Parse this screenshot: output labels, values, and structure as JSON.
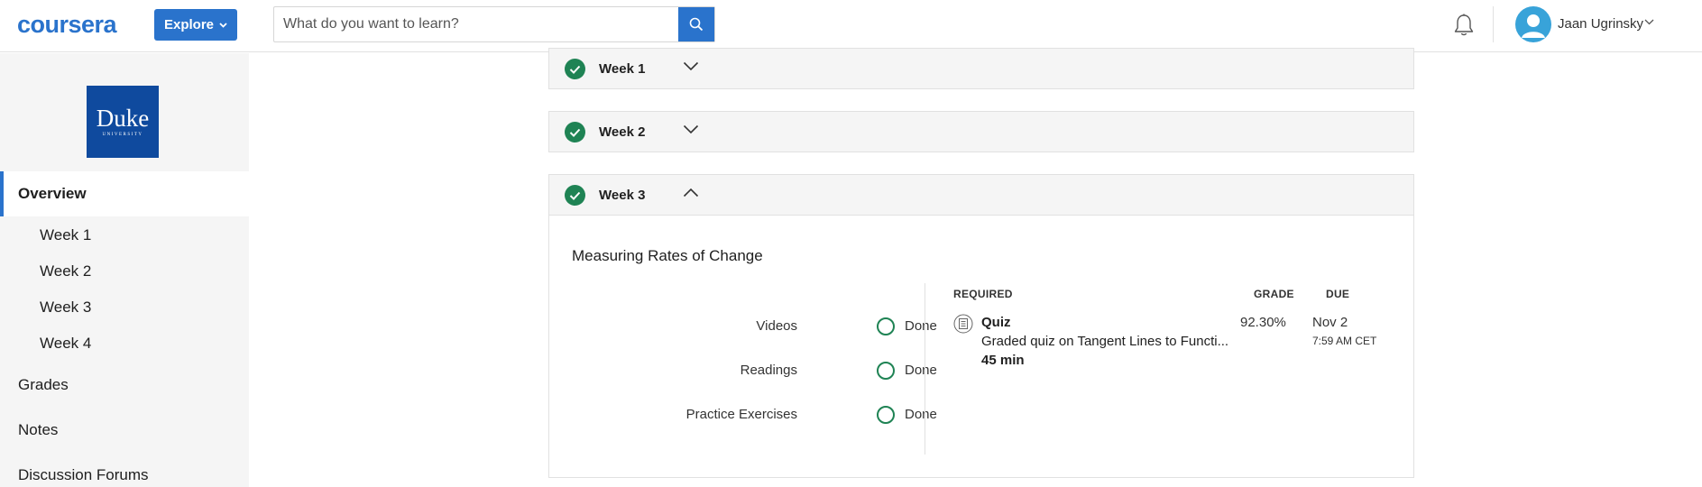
{
  "header": {
    "logo": "coursera",
    "explore_label": "Explore",
    "search_placeholder": "What do you want to learn?",
    "user_name": "Jaan Ugrinsky"
  },
  "sidebar": {
    "university_logo": {
      "word": "Duke",
      "sub": "UNIVERSITY"
    },
    "overview_label": "Overview",
    "weeks": [
      "Week 1",
      "Week 2",
      "Week 3",
      "Week 4"
    ],
    "grades_label": "Grades",
    "notes_label": "Notes",
    "forums_label": "Discussion Forums"
  },
  "weeks": [
    {
      "label": "Week 1",
      "completed": true,
      "expanded": false
    },
    {
      "label": "Week 2",
      "completed": true,
      "expanded": false
    },
    {
      "label": "Week 3",
      "completed": true,
      "expanded": true
    }
  ],
  "week3": {
    "module_title": "Measuring Rates of Change",
    "progress": [
      {
        "label": "Videos",
        "status": "Done"
      },
      {
        "label": "Readings",
        "status": "Done"
      },
      {
        "label": "Practice Exercises",
        "status": "Done"
      }
    ],
    "columns": {
      "required": "REQUIRED",
      "grade": "GRADE",
      "due": "DUE"
    },
    "items": [
      {
        "type": "Quiz",
        "name": "Graded quiz on Tangent Lines to Functi...",
        "duration": "45 min",
        "grade": "92.30%",
        "due_date": "Nov 2",
        "due_time": "7:59 AM CET"
      }
    ]
  },
  "colors": {
    "accent": "#2a73cc",
    "success": "#1f8354",
    "sidebar_bg": "#f5f5f5",
    "duke_blue": "#0f4a9e"
  }
}
